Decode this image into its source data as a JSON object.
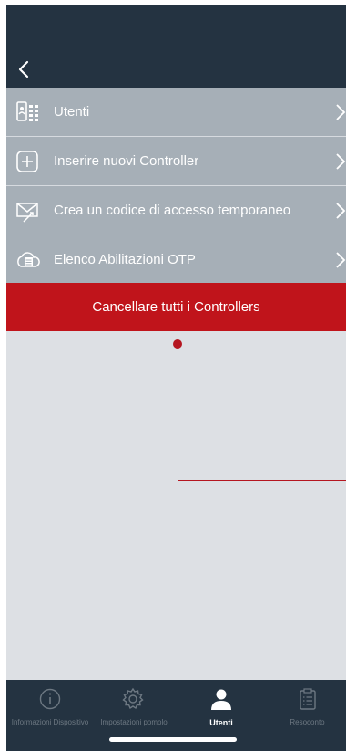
{
  "menu": {
    "items": [
      {
        "label": "Utenti",
        "icon": "users-device-icon"
      },
      {
        "label": "Inserire nuovi Controller",
        "icon": "plus-square-icon"
      },
      {
        "label": "Crea un codice di accesso temporaneo",
        "icon": "envelope-send-icon"
      },
      {
        "label": "Elenco Abilitazioni OTP",
        "icon": "cloud-list-icon"
      }
    ],
    "delete_all_label": "Cancellare tutti i Controllers"
  },
  "tabs": [
    {
      "label": "Informazioni Dispositivo",
      "icon": "info-circle-icon",
      "active": false
    },
    {
      "label": "Impostazioni pomolo",
      "icon": "gear-icon",
      "active": false
    },
    {
      "label": "Utenti",
      "icon": "user-icon",
      "active": true
    },
    {
      "label": "Resoconto",
      "icon": "clipboard-icon",
      "active": false
    }
  ],
  "colors": {
    "header": "#243341",
    "menu_row": "#a6afb7",
    "danger": "#c0141b",
    "content_bg": "#dde0e4"
  }
}
